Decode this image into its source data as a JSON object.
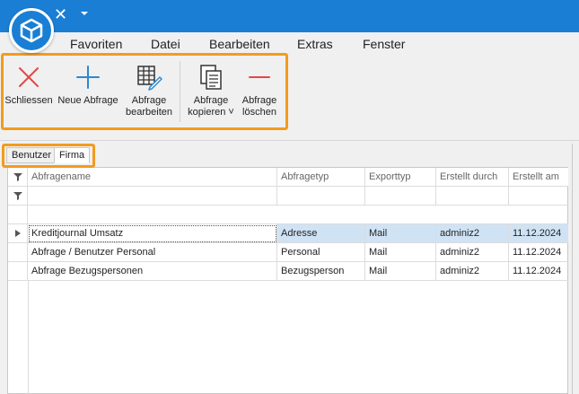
{
  "menu": [
    "Favoriten",
    "Datei",
    "Bearbeiten",
    "Extras",
    "Fenster"
  ],
  "ribbon": {
    "buttons": [
      {
        "label": "Schliessen",
        "icon": "close-x-icon"
      },
      {
        "label": "Neue Abfrage",
        "icon": "plus-icon"
      },
      {
        "label": "Abfrage\nbearbeiten",
        "icon": "table-edit-icon"
      },
      {
        "label": "Abfrage\nkopieren ˅",
        "icon": "copy-document-icon"
      },
      {
        "label": "Abfrage\nlöschen",
        "icon": "minus-icon"
      }
    ]
  },
  "tabs": [
    {
      "label": "Benutzer",
      "active": false
    },
    {
      "label": "Firma",
      "active": true
    }
  ],
  "grid": {
    "columns": [
      "Abfragename",
      "Abfragetyp",
      "Exporttyp",
      "Erstellt durch",
      "Erstellt am"
    ],
    "rows": [
      [
        "Kreditjournal Umsatz",
        "Adresse",
        "Mail",
        "adminiz2",
        "11.12.2024"
      ],
      [
        "Abfrage / Benutzer Personal",
        "Personal",
        "Mail",
        "adminiz2",
        "11.12.2024"
      ],
      [
        "Abfrage Bezugspersonen",
        "Bezugsperson",
        "Mail",
        "adminiz2",
        "11.12.2024"
      ]
    ],
    "selected_row": 0
  },
  "colors": {
    "titlebar": "#1a7fd4",
    "highlight": "#f39b1d",
    "close_icon": "#e04848",
    "plus_icon": "#2a8ad6",
    "minus_icon": "#e04848",
    "selected_cell": "#cfe3f5"
  }
}
